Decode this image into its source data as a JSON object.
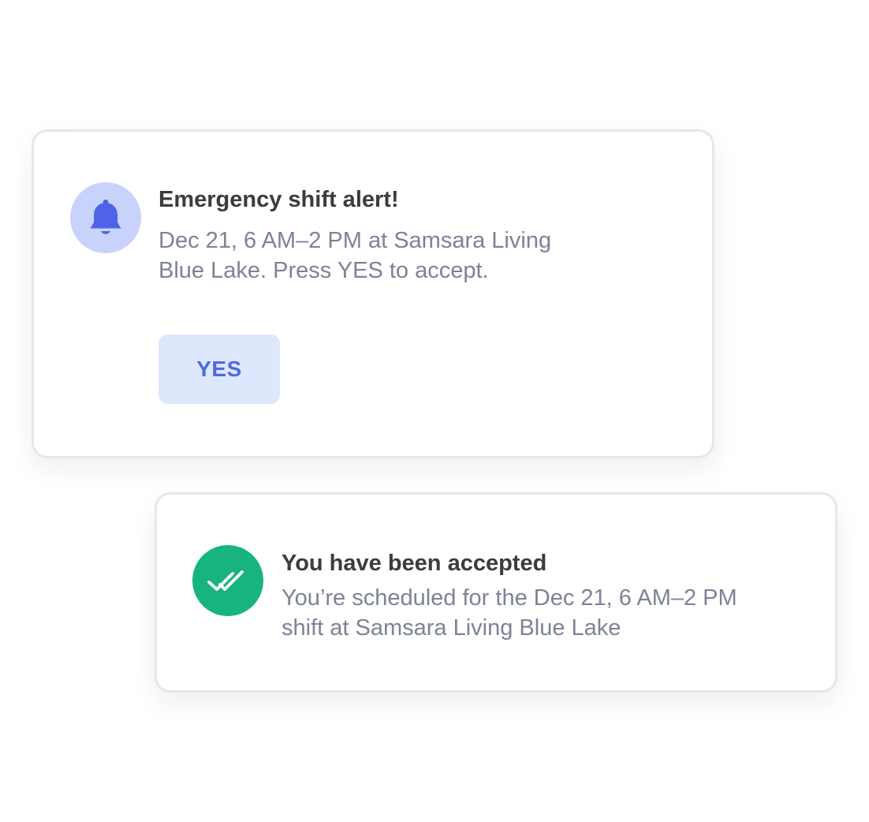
{
  "alert_card": {
    "icon": "bell-icon",
    "title": "Emergency shift alert!",
    "body_line1": "Dec 21, 6 AM–2 PM at Samsara Living",
    "body_line2": "Blue Lake. Press YES to accept.",
    "yes_label": "YES",
    "colors": {
      "icon_bg": "#c7d3fb",
      "icon_fg": "#4f63e6",
      "button_bg": "#dde8fd",
      "button_text": "#5167e0"
    }
  },
  "accepted_card": {
    "icon": "double-check-icon",
    "title": "You have been accepted",
    "body_line1": "You’re scheduled for the Dec 21, 6 AM–2 PM",
    "body_line2": "shift at Samsara Living Blue Lake",
    "colors": {
      "icon_bg": "#18b47e",
      "icon_fg": "#ffffff"
    }
  },
  "colors": {
    "title_text": "#3b3b40",
    "body_text": "#7d8396",
    "card_border": "#e7e7ea"
  }
}
